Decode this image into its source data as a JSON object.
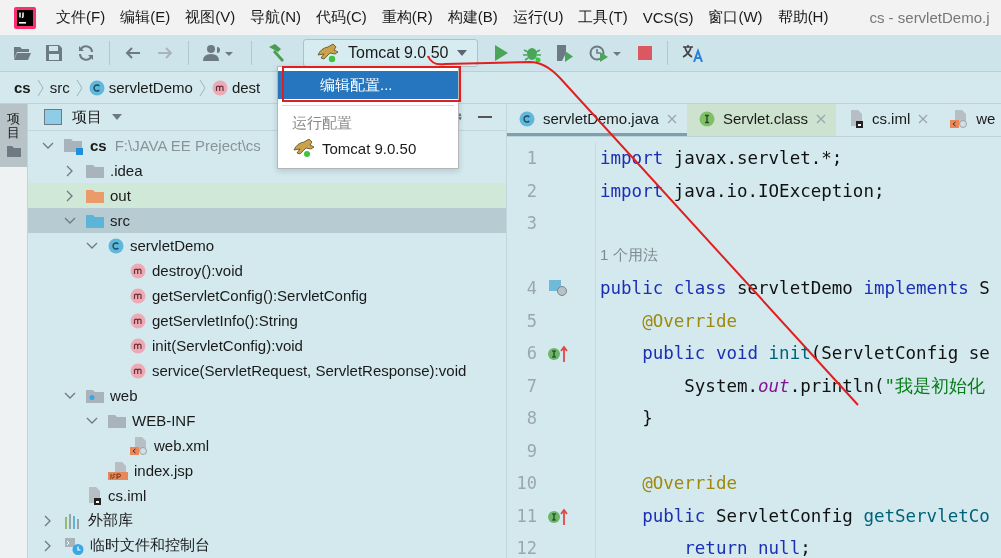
{
  "menu_bar": {
    "items": [
      "文件(F)",
      "编辑(E)",
      "视图(V)",
      "导航(N)",
      "代码(C)",
      "重构(R)",
      "构建(B)",
      "运行(U)",
      "工具(T)",
      "VCS(S)",
      "窗口(W)",
      "帮助(H)"
    ],
    "title": "cs - servletDemo.j"
  },
  "toolbar": {
    "run_config": {
      "label": "Tomcat 9.0.50"
    }
  },
  "breadcrumb": [
    {
      "label": "cs",
      "kind": "project"
    },
    {
      "label": "src",
      "kind": "folder"
    },
    {
      "label": "servletDemo",
      "kind": "class"
    },
    {
      "label": "dest",
      "kind": "method"
    }
  ],
  "run_config_popup": {
    "items": [
      {
        "kind": "action",
        "label": "编辑配置...",
        "selected": true
      },
      {
        "kind": "separator"
      },
      {
        "kind": "heading",
        "label": "运行配置"
      },
      {
        "kind": "config",
        "label": "Tomcat 9.0.50",
        "selected": false
      }
    ]
  },
  "side_strip": {
    "tabs": [
      {
        "label": "项目",
        "selected": true
      }
    ]
  },
  "project_panel": {
    "title": "项目",
    "tree": [
      {
        "label": "cs",
        "path": "F:\\JAVA EE Preject\\cs",
        "kind": "module",
        "expanded": true,
        "selected": false,
        "children": [
          {
            "label": ".idea",
            "kind": "folder",
            "expanded": false,
            "selected": false
          },
          {
            "label": "out",
            "kind": "excluded",
            "expanded": false,
            "selected": false
          },
          {
            "label": "src",
            "kind": "source",
            "expanded": true,
            "selected": true,
            "children": [
              {
                "label": "servletDemo",
                "kind": "class",
                "expanded": true,
                "selected": false,
                "children": [
                  {
                    "label": "destroy():void",
                    "kind": "method",
                    "selected": false
                  },
                  {
                    "label": "getServletConfig():ServletConfig",
                    "kind": "method",
                    "selected": false
                  },
                  {
                    "label": "getServletInfo():String",
                    "kind": "method",
                    "selected": false
                  },
                  {
                    "label": "init(ServletConfig):void",
                    "kind": "method",
                    "selected": false
                  },
                  {
                    "label": "service(ServletRequest, ServletResponse):void",
                    "kind": "method",
                    "selected": false
                  }
                ]
              }
            ]
          },
          {
            "label": "web",
            "kind": "web",
            "expanded": true,
            "selected": false,
            "children": [
              {
                "label": "WEB-INF",
                "kind": "folder",
                "expanded": true,
                "selected": false,
                "children": [
                  {
                    "label": "web.xml",
                    "kind": "xml",
                    "selected": false
                  }
                ]
              },
              {
                "label": "index.jsp",
                "kind": "jsp",
                "selected": false
              }
            ]
          },
          {
            "label": "cs.iml",
            "kind": "iml",
            "selected": false
          }
        ]
      },
      {
        "label": "外部库",
        "kind": "library",
        "expanded": false,
        "selected": false
      },
      {
        "label": "临时文件和控制台",
        "kind": "scratch",
        "expanded": false,
        "selected": false
      }
    ]
  },
  "editor": {
    "tabs": [
      {
        "label": "servletDemo.java",
        "kind": "class",
        "library": false,
        "selected": true
      },
      {
        "label": "Servlet.class",
        "kind": "interface",
        "library": true,
        "selected": false
      },
      {
        "label": "cs.iml",
        "kind": "iml",
        "library": false,
        "selected": false
      },
      {
        "label": "we",
        "kind": "xml",
        "library": false,
        "selected": false
      }
    ],
    "lines": [
      {
        "kind": "plain",
        "number": "1",
        "tokens": [
          {
            "kind": "keyword",
            "text": "import"
          },
          {
            "kind": "plain",
            "text": " javax.servlet.*;"
          }
        ]
      },
      {
        "kind": "plain",
        "number": "2",
        "tokens": [
          {
            "kind": "keyword",
            "text": "import"
          },
          {
            "kind": "plain",
            "text": " java.io.IOException;"
          }
        ]
      },
      {
        "kind": "plain",
        "number": "3"
      },
      {
        "kind": "hint",
        "text": "1 个用法"
      },
      {
        "kind": "class",
        "number": "4",
        "tokens": [
          {
            "kind": "keyword",
            "text": "public class"
          },
          {
            "kind": "plain",
            "text": " servletDemo "
          },
          {
            "kind": "keyword",
            "text": "implements"
          },
          {
            "kind": "plain",
            "text": " S"
          }
        ]
      },
      {
        "kind": "plain",
        "number": "5",
        "tokens": [
          {
            "kind": "annotation",
            "text": "    @Override"
          }
        ]
      },
      {
        "kind": "override",
        "number": "6",
        "tokens": [
          {
            "kind": "keyword",
            "text": "    public void"
          },
          {
            "kind": "method",
            "text": " init"
          },
          {
            "kind": "plain",
            "text": "(ServletConfig se"
          }
        ]
      },
      {
        "kind": "plain",
        "number": "7",
        "tokens": [
          {
            "kind": "plain",
            "text": "        System."
          },
          {
            "kind": "static",
            "text": "out"
          },
          {
            "kind": "plain",
            "text": ".println("
          },
          {
            "kind": "string",
            "text": "\"我是初始化"
          }
        ]
      },
      {
        "kind": "plain",
        "number": "8",
        "tokens": [
          {
            "kind": "plain",
            "text": "    }"
          }
        ]
      },
      {
        "kind": "plain",
        "number": "9"
      },
      {
        "kind": "plain",
        "number": "10",
        "tokens": [
          {
            "kind": "annotation",
            "text": "    @Override"
          }
        ]
      },
      {
        "kind": "override",
        "number": "11",
        "tokens": [
          {
            "kind": "keyword",
            "text": "    public"
          },
          {
            "kind": "plain",
            "text": " ServletConfig "
          },
          {
            "kind": "method",
            "text": "getServletCo"
          }
        ]
      },
      {
        "kind": "plain",
        "number": "12",
        "tokens": [
          {
            "kind": "keyword",
            "text": "        return null"
          },
          {
            "kind": "plain",
            "text": ";"
          }
        ]
      }
    ]
  }
}
